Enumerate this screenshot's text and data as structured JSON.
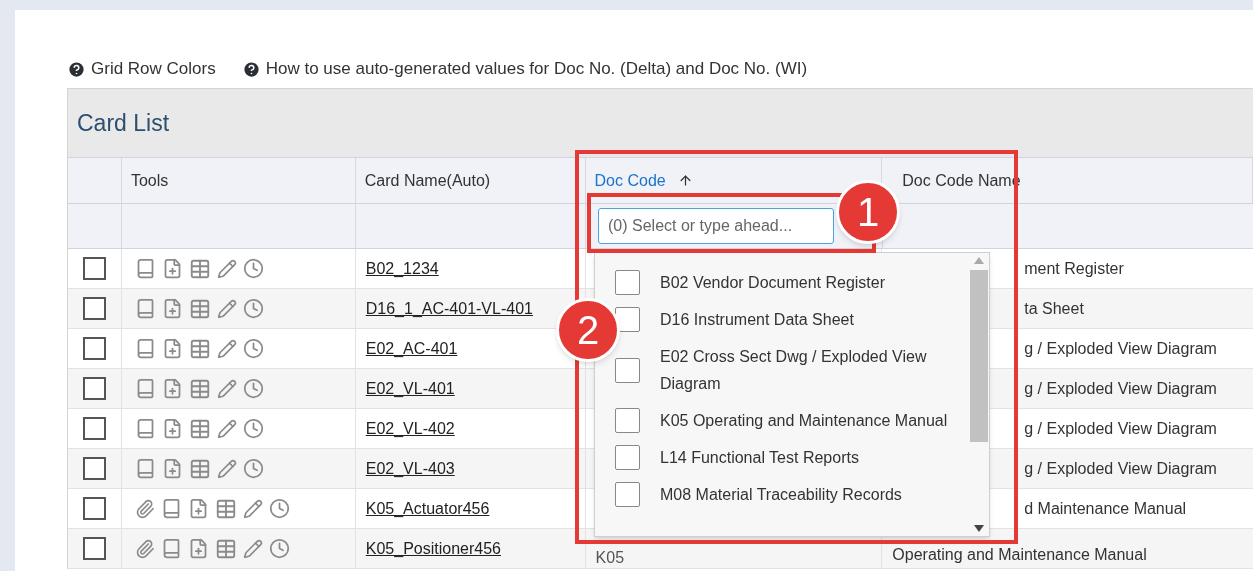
{
  "help_links": [
    {
      "label": "Grid Row Colors"
    },
    {
      "label": "How to use auto-generated values for Doc No. (Delta) and Doc No. (WI)"
    }
  ],
  "panel": {
    "title": "Card List"
  },
  "columns": [
    {
      "label": "Tools",
      "sorted": false
    },
    {
      "label": "Card Name(Auto)",
      "sorted": false
    },
    {
      "label": "Doc Code",
      "sorted": true
    },
    {
      "label": "Doc Code Name",
      "sorted": false
    }
  ],
  "filter": {
    "placeholder": "(0) Select or type ahead..."
  },
  "rows": [
    {
      "checked": false,
      "attachment": false,
      "card_name": "B02_1234",
      "doc_code_name": "ment Register"
    },
    {
      "checked": false,
      "attachment": false,
      "card_name": "D16_1_AC-401-VL-401",
      "doc_code_name": "ta Sheet"
    },
    {
      "checked": false,
      "attachment": false,
      "card_name": "E02_AC-401",
      "doc_code_name": "g / Exploded View Diagram"
    },
    {
      "checked": false,
      "attachment": false,
      "card_name": "E02_VL-401",
      "doc_code_name": "g / Exploded View Diagram"
    },
    {
      "checked": false,
      "attachment": false,
      "card_name": "E02_VL-402",
      "doc_code_name": "g / Exploded View Diagram"
    },
    {
      "checked": false,
      "attachment": false,
      "card_name": "E02_VL-403",
      "doc_code_name": "g / Exploded View Diagram"
    },
    {
      "checked": false,
      "attachment": true,
      "card_name": "K05_Actuator456",
      "doc_code_name": "d Maintenance Manual"
    },
    {
      "checked": false,
      "attachment": true,
      "card_name": "K05_Positioner456",
      "doc_code": "K05",
      "doc_code_name": "Operating and Maintenance Manual"
    }
  ],
  "dropdown": {
    "options": [
      {
        "label": "B02 Vendor Document Register",
        "checked": false
      },
      {
        "label": "D16 Instrument Data Sheet",
        "checked": false
      },
      {
        "label": "E02 Cross Sect Dwg / Exploded View Diagram",
        "checked": false
      },
      {
        "label": "K05 Operating and Maintenance Manual",
        "checked": false
      },
      {
        "label": "L14 Functional Test Reports",
        "checked": false
      },
      {
        "label": "M08 Material Traceability Records",
        "checked": false
      }
    ]
  },
  "callouts": [
    {
      "label": "1"
    },
    {
      "label": "2"
    }
  ]
}
